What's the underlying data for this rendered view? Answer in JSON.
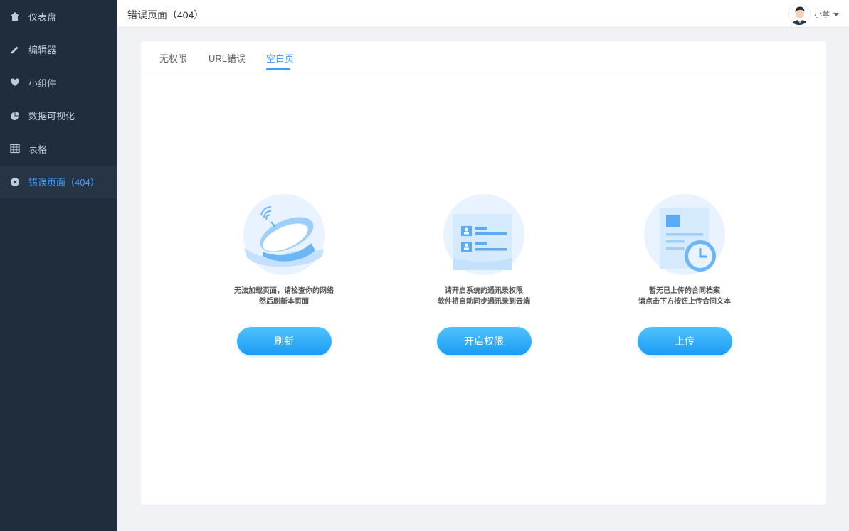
{
  "sidebar": {
    "items": [
      {
        "label": "仪表盘",
        "icon": "dashboard-icon"
      },
      {
        "label": "编辑器",
        "icon": "pencil-icon"
      },
      {
        "label": "小组件",
        "icon": "widget-icon"
      },
      {
        "label": "数据可视化",
        "icon": "pie-chart-icon"
      },
      {
        "label": "表格",
        "icon": "table-icon"
      },
      {
        "label": "错误页面（404）",
        "icon": "close-circle-icon"
      }
    ],
    "active_index": 5
  },
  "header": {
    "title": "错误页面（404）",
    "user_name": "小葶"
  },
  "tabs": [
    {
      "label": "无权限"
    },
    {
      "label": "URL错误"
    },
    {
      "label": "空白页"
    }
  ],
  "active_tab": 2,
  "panels": [
    {
      "line1": "无法加载页面，请检查你的网络",
      "line2": "然后刷新本页面",
      "button": "刷新",
      "illustration": "satellite-dish-illustration"
    },
    {
      "line1": "请开启系统的通讯录权限",
      "line2": "软件将自动同步通讯录到云端",
      "button": "开启权限",
      "illustration": "contacts-illustration"
    },
    {
      "line1": "暂无已上传的合同档案",
      "line2": "请点击下方按钮上传合同文本",
      "button": "上传",
      "illustration": "document-clock-illustration"
    }
  ],
  "colors": {
    "sidebar_bg": "#1f2d3d",
    "accent": "#409eff",
    "button": "#1a9af4",
    "page_bg": "#f0f2f5"
  }
}
